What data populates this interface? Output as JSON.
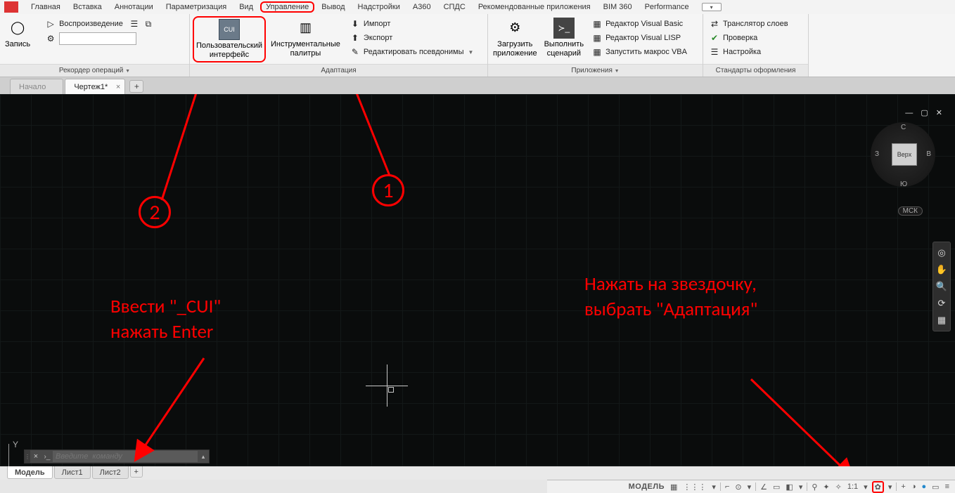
{
  "menu": {
    "items": [
      "Главная",
      "Вставка",
      "Аннотации",
      "Параметризация",
      "Вид",
      "Управление",
      "Вывод",
      "Надстройки",
      "A360",
      "СПДС",
      "Рекомендованные приложения",
      "BIM 360",
      "Performance"
    ],
    "active_index": 5
  },
  "ribbon": {
    "panels": [
      {
        "title": "Рекордер операций",
        "record_label": "Запись",
        "play_label": "Воспроизведение"
      },
      {
        "title": "Адаптация",
        "cui_label1": "Пользовательский",
        "cui_label2": "интерфейс",
        "palettes_label1": "Инструментальные",
        "palettes_label2": "палитры",
        "import_label": "Импорт",
        "export_label": "Экспорт",
        "aliases_label": "Редактировать псевдонимы"
      },
      {
        "title": "Приложения",
        "load_label1": "Загрузить",
        "load_label2": "приложение",
        "run_label1": "Выполнить",
        "run_label2": "сценарий",
        "vbe_label": "Редактор Visual Basic",
        "vle_label": "Редактор Visual LISP",
        "macro_label": "Запустить макрос VBA"
      },
      {
        "title": "Стандарты оформления",
        "trans_label": "Транслятор  слоев",
        "check_label": "Проверка",
        "config_label": "Настройка"
      }
    ]
  },
  "doc_tabs": {
    "start_label": "Начало",
    "drawing_label": "Чертеж1*"
  },
  "viewcube": {
    "face": "Верх",
    "n": "С",
    "s": "Ю",
    "w": "З",
    "e": "В",
    "mck": "МСК"
  },
  "ucs": {
    "y": "Y"
  },
  "cmd": {
    "placeholder": "Введите  команду"
  },
  "layout_tabs": {
    "model": "Модель",
    "l1": "Лист1",
    "l2": "Лист2"
  },
  "status": {
    "model": "МОДЕЛЬ",
    "scale": "1:1"
  },
  "annotations": {
    "n1": "1",
    "n2": "2",
    "leftText": "Ввести \"_CUI\"\nнажать Enter",
    "rightText": "Нажать на звездочку, выбрать \"Адаптация\""
  }
}
